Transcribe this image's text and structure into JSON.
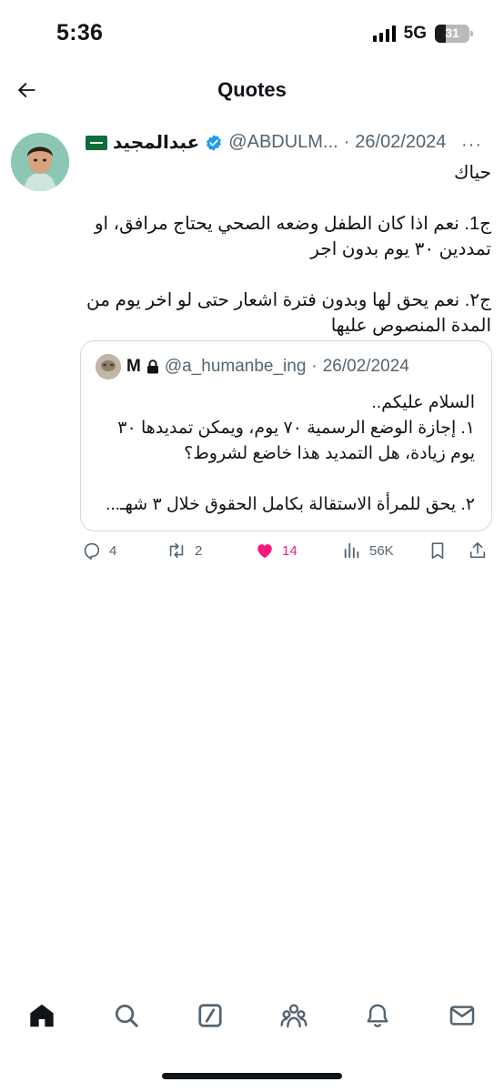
{
  "status_bar": {
    "time": "5:36",
    "network": "5G",
    "battery": "31",
    "battery_level": 0.31
  },
  "header": {
    "title": "Quotes",
    "back_icon": "arrow-left-icon"
  },
  "tweet": {
    "display_name": "عبدالمجيد",
    "flag_icon": "saudi-flag-icon",
    "verified_icon": "verified-badge-icon",
    "handle": "@ABDULM...",
    "separator": "·",
    "date": "26/02/2024",
    "more_label": "···",
    "body": {
      "line1": "حياك",
      "line2": "ج1. نعم اذا كان الطفل وضعه الصحي يحتاج مرافق، او",
      "line3": "تمددين ٣٠ يوم بدون اجر",
      "line4": "ج٢. نعم يحق لها وبدون فترة اشعار حتى لو اخر يوم من",
      "line5": "المدة المنصوص عليها"
    }
  },
  "quoted_tweet": {
    "display_name": "M",
    "lock_icon": "lock-icon",
    "handle": "@a_humanbe_ing",
    "separator": "·",
    "date": "26/02/2024",
    "body": {
      "line1": "السلام عليكم..",
      "line2": "١. إجازة الوضع الرسمية ٧٠ يوم، ويمكن تمديدها ٣٠",
      "line3": "يوم زيادة، هل التمديد هذا خاضع لشروط؟",
      "line4": "٢. يحق للمرأة الاستقالة بكامل الحقوق خلال ٣ شهـ..."
    }
  },
  "actions": {
    "replies": "4",
    "reposts": "2",
    "likes": "14",
    "views": "56K",
    "like_color": "#f91880",
    "muted_color": "#536471"
  },
  "bottom_nav": {
    "items": [
      "home-icon",
      "search-icon",
      "grok-icon",
      "communities-icon",
      "notifications-icon",
      "messages-icon"
    ]
  }
}
